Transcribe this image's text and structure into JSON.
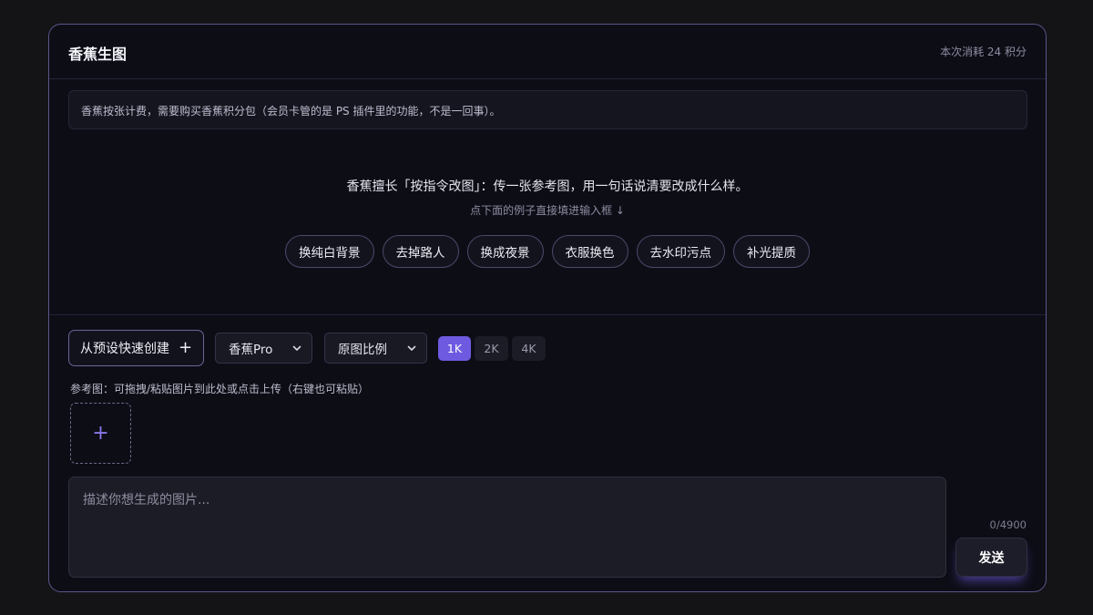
{
  "header": {
    "title": "香蕉生图",
    "cost": "本次消耗 24 积分"
  },
  "notice": "香蕉按张计费，需要购买香蕉积分包（会员卡管的是 PS 插件里的功能，不是一回事）。",
  "intro": {
    "headline": "香蕉擅长「按指令改图」：传一张参考图，用一句话说清要改成什么样。",
    "hint": "点下面的例子直接填进输入框 ↓"
  },
  "examples": [
    "换纯白背景",
    "去掉路人",
    "换成夜景",
    "衣服换色",
    "去水印污点",
    "补光提质"
  ],
  "controls": {
    "preset_button": "从预设快速创建",
    "preset_icon": "plus-icon",
    "model_select": "香蕉Pro",
    "ratio_select": "原图比例",
    "resolutions": [
      "1K",
      "2K",
      "4K"
    ],
    "selected_resolution": "1K"
  },
  "reference": {
    "label": "参考图：可拖拽/粘贴图片到此处或点击上传（右键也可粘贴）",
    "upload_icon": "plus-icon"
  },
  "prompt": {
    "placeholder": "描述你想生成的图片...",
    "value": "",
    "counter": "0/4900"
  },
  "send_button": "发送",
  "colors": {
    "accent": "#6d5ae0",
    "panel_border": "#5b5488",
    "background": "#141416"
  }
}
